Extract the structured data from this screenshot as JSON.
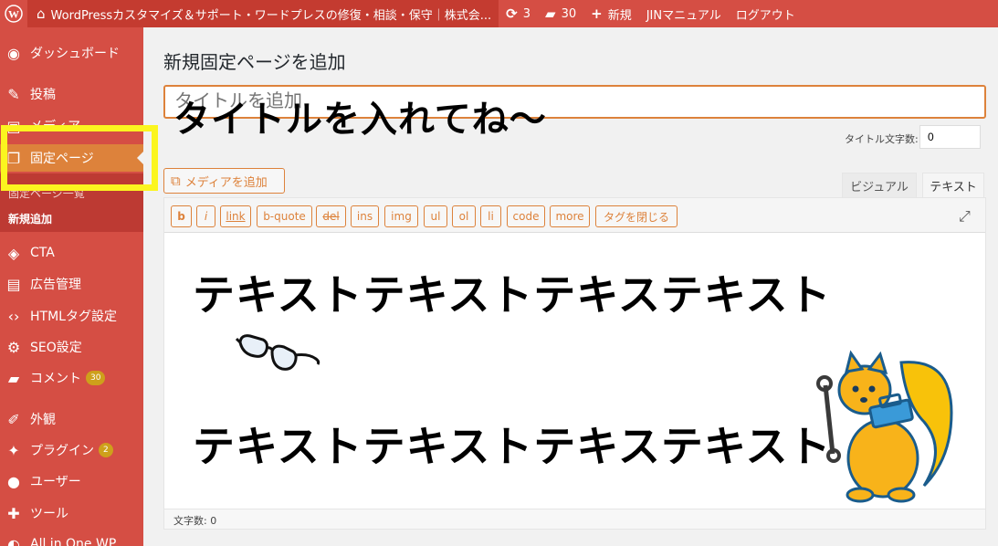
{
  "adminbar": {
    "site_title": "WordPressカスタマイズ＆サポート・ワードプレスの修復・相談・保守｜株式会...",
    "updates_count": "3",
    "comments_count": "30",
    "new_label": "新規",
    "jin_manual": "JINマニュアル",
    "logout": "ログアウト"
  },
  "sidebar": {
    "dashboard": "ダッシュボード",
    "posts": "投稿",
    "media": "メディア",
    "pages": "固定ページ",
    "pages_list": "固定ページ一覧",
    "pages_new": "新規追加",
    "cta": "CTA",
    "ads": "広告管理",
    "html_tags": "HTMLタグ設定",
    "seo": "SEO設定",
    "comments": "コメント",
    "comments_badge": "30",
    "appearance": "外観",
    "plugins": "プラグイン",
    "plugins_badge": "2",
    "users": "ユーザー",
    "tools": "ツール",
    "aio": "All in One WP"
  },
  "main": {
    "page_title": "新規固定ページを追加",
    "title_placeholder": "タイトルを追加",
    "overlay_text": "タイトルを入れてね～",
    "counter_label": "タイトル文字数:",
    "counter_value": "0",
    "add_media": "メディアを追加",
    "tab_visual": "ビジュアル",
    "tab_text": "テキスト",
    "quicktags": [
      "b",
      "i",
      "link",
      "b-quote",
      "del",
      "ins",
      "img",
      "ul",
      "ol",
      "li",
      "code",
      "more",
      "タグを閉じる"
    ],
    "content_line1": "テキストテキストテキステキスト",
    "content_line2": "テキストテキストテキステキスト",
    "word_count": "文字数: 0"
  },
  "colors": {
    "accent": "#dd823b",
    "admin_red": "#d54e44",
    "highlight": "#fbf51f"
  }
}
